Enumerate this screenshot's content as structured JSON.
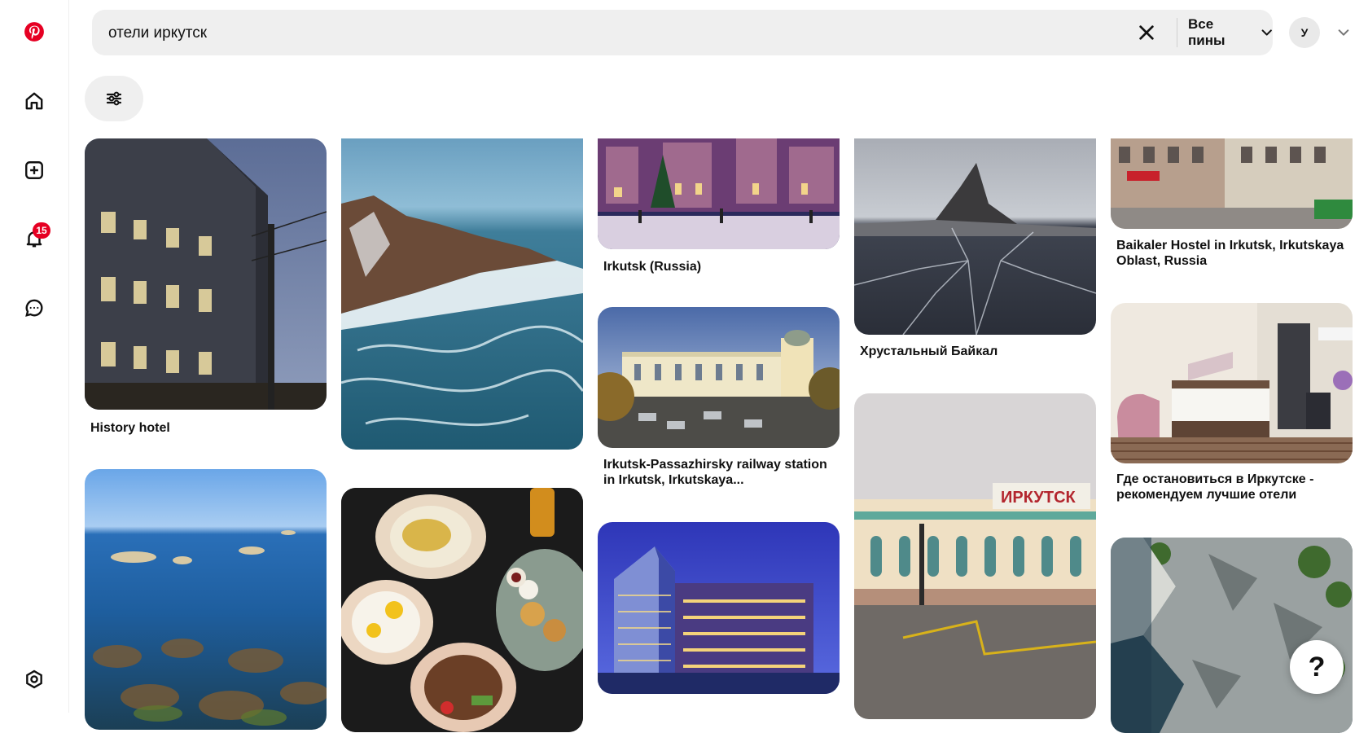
{
  "search": {
    "query": "отели иркутск",
    "scope_label": "Все пины"
  },
  "account": {
    "avatar_letter": "У"
  },
  "nav": {
    "notifications_count": "15"
  },
  "help": {
    "label": "?"
  },
  "pins": [
    {
      "title": "History hotel"
    },
    {
      "title": ""
    },
    {
      "title": "Irkutsk (Russia)"
    },
    {
      "title": "Хрустальный Байкал"
    },
    {
      "title": "Baikaler Hostel in Irkutsk, Irkutskaya Oblast, Russia"
    },
    {
      "title": ""
    },
    {
      "title": ""
    },
    {
      "title": "Irkutsk-Passazhirsky railway station in Irkutsk, Irkutskaya..."
    },
    {
      "title": ""
    },
    {
      "title": "Где остановиться в Иркутске - рекомендуем лучшие отели"
    },
    {
      "title": ""
    },
    {
      "title": ""
    }
  ],
  "colors": {
    "brand": "#e60023",
    "search_bg": "#efefef"
  }
}
